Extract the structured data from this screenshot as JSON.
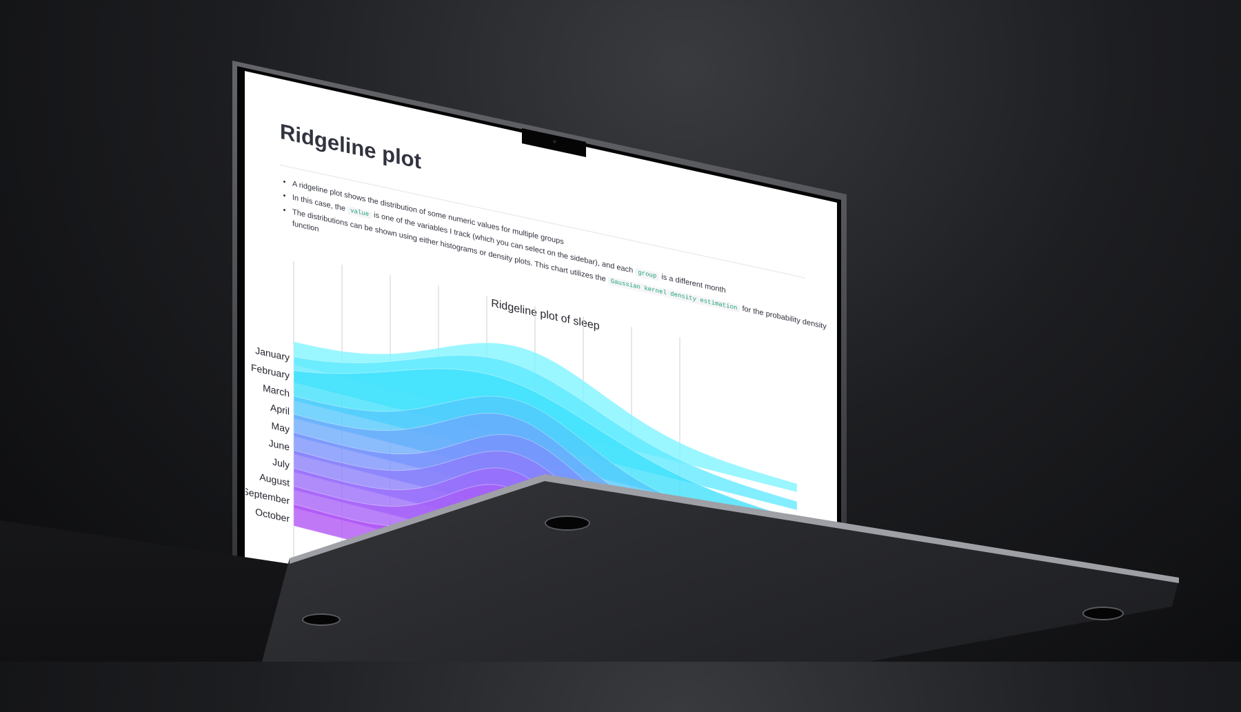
{
  "page": {
    "title": "Ridgeline plot",
    "bullets": [
      {
        "text": "A ridgeline plot shows the distribution of some numeric values for multiple groups"
      },
      {
        "pre": "In this case, the ",
        "code1": "value",
        "mid": " is one of the variables I track (which you can select on the sidebar), and each ",
        "code2": "group",
        "post": " is a different month"
      },
      {
        "pre": "The distributions can be shown using either histograms or density plots. This chart utilizes the ",
        "code1": "Gaussian kernel density estimation",
        "post": " for the probability density function"
      }
    ]
  },
  "chart_data": {
    "type": "area",
    "title": "Ridgeline plot of sleep",
    "categories": [
      "January",
      "February",
      "March",
      "April",
      "May",
      "June",
      "July",
      "August",
      "September",
      "October"
    ],
    "colors": [
      "#7ef3ff",
      "#5fe9ff",
      "#3ee0fb",
      "#52c8fb",
      "#6aa9fb",
      "#7a91fb",
      "#8b7dfb",
      "#9a6bfa",
      "#a65ff7",
      "#b052f5"
    ],
    "peaks": [
      0.45,
      0.42,
      0.4,
      0.44,
      0.43,
      0.45,
      0.44,
      0.43,
      0.42,
      0.41
    ],
    "widths": [
      0.16,
      0.18,
      0.2,
      0.14,
      0.13,
      0.12,
      0.12,
      0.11,
      0.11,
      0.1
    ],
    "grid": true
  },
  "icons": {
    "expand": "expand-icon"
  }
}
